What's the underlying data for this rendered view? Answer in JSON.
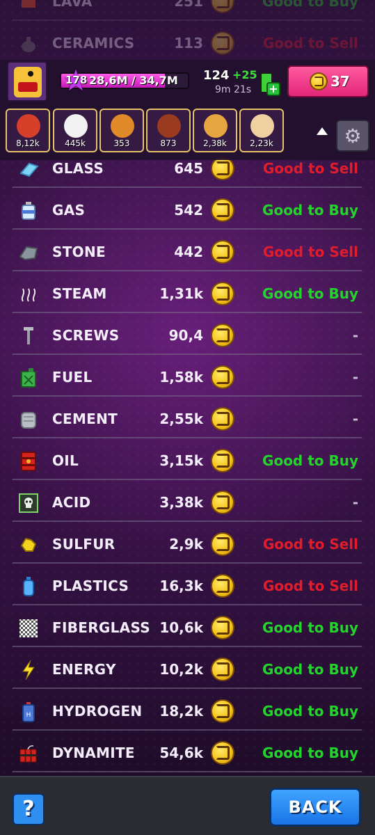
{
  "hidden_rows": [
    {
      "name": "LAVA",
      "price": "251",
      "status": "Good to Buy",
      "status_type": "buy"
    },
    {
      "name": "CERAMICS",
      "price": "113",
      "status": "Good to Sell",
      "status_type": "sell"
    }
  ],
  "hud": {
    "level": "178",
    "xp_text": "28,6M / 34,7M",
    "xp_progress": 0.82,
    "energy_value": "124",
    "energy_plus": "+25",
    "energy_timer": "9m 21s",
    "gems": "37"
  },
  "resources": [
    {
      "icon": "meat-icon",
      "value": "8,12k",
      "color": "#d6402a"
    },
    {
      "icon": "rice-icon",
      "value": "445k",
      "color": "#f2f2f2"
    },
    {
      "icon": "noodles-bowl-icon",
      "value": "353",
      "color": "#e08a2a"
    },
    {
      "icon": "meatball-icon",
      "value": "873",
      "color": "#9a3a1f"
    },
    {
      "icon": "pancakes-icon",
      "value": "2,38k",
      "color": "#e7a53f"
    },
    {
      "icon": "dumpling-icon",
      "value": "2,23k",
      "color": "#f0d0a0"
    }
  ],
  "rows": [
    {
      "name": "GLASS",
      "price": "645",
      "status": "Good to Sell",
      "status_type": "sell",
      "icon": "glass-icon"
    },
    {
      "name": "GAS",
      "price": "542",
      "status": "Good to Buy",
      "status_type": "buy",
      "icon": "gas-canister-icon"
    },
    {
      "name": "STONE",
      "price": "442",
      "status": "Good to Sell",
      "status_type": "sell",
      "icon": "stone-icon"
    },
    {
      "name": "STEAM",
      "price": "1,31k",
      "status": "Good to Buy",
      "status_type": "buy",
      "icon": "steam-icon"
    },
    {
      "name": "SCREWS",
      "price": "90,4",
      "status": "-",
      "status_type": "neutral",
      "icon": "screw-icon"
    },
    {
      "name": "FUEL",
      "price": "1,58k",
      "status": "-",
      "status_type": "neutral",
      "icon": "fuel-can-icon"
    },
    {
      "name": "CEMENT",
      "price": "2,55k",
      "status": "-",
      "status_type": "neutral",
      "icon": "cement-bag-icon"
    },
    {
      "name": "OIL",
      "price": "3,15k",
      "status": "Good to Buy",
      "status_type": "buy",
      "icon": "oil-barrel-icon"
    },
    {
      "name": "ACID",
      "price": "3,38k",
      "status": "-",
      "status_type": "neutral",
      "icon": "acid-skull-icon"
    },
    {
      "name": "SULFUR",
      "price": "2,9k",
      "status": "Good to Sell",
      "status_type": "sell",
      "icon": "sulfur-icon"
    },
    {
      "name": "PLASTICS",
      "price": "16,3k",
      "status": "Good to Sell",
      "status_type": "sell",
      "icon": "plastic-bottle-icon"
    },
    {
      "name": "FIBERGLASS",
      "price": "10,6k",
      "status": "Good to Buy",
      "status_type": "buy",
      "icon": "fiberglass-icon"
    },
    {
      "name": "ENERGY",
      "price": "10,2k",
      "status": "Good to Buy",
      "status_type": "buy",
      "icon": "lightning-icon"
    },
    {
      "name": "HYDROGEN",
      "price": "18,2k",
      "status": "Good to Buy",
      "status_type": "buy",
      "icon": "hydrogen-tank-icon"
    },
    {
      "name": "DYNAMITE",
      "price": "54,6k",
      "status": "Good to Buy",
      "status_type": "buy",
      "icon": "dynamite-icon"
    }
  ],
  "footer": {
    "help_label": "?",
    "back_label": "BACK"
  },
  "colors": {
    "buy": "#22d52a",
    "sell": "#e21c2a",
    "neutral": "#c8c0d4",
    "gem_button": "#ff5a9e",
    "back_button": "#2f8ff0"
  }
}
